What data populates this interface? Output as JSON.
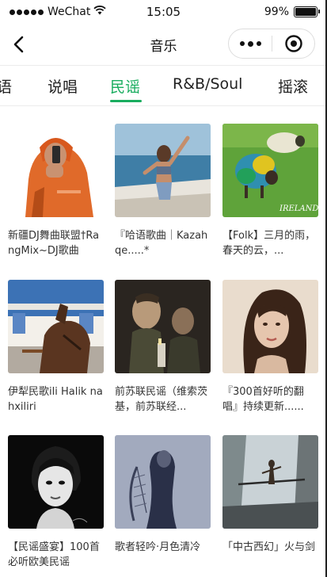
{
  "status_bar": {
    "carrier": "WeChat",
    "time": "15:05",
    "battery_text": "99%",
    "battery_level": 0.99
  },
  "nav": {
    "title": "音乐"
  },
  "tabs": [
    {
      "label": "语",
      "active": false
    },
    {
      "label": "说唱",
      "active": false
    },
    {
      "label": "民谣",
      "active": true
    },
    {
      "label": "R&B/Soul",
      "active": false
    },
    {
      "label": "摇滚",
      "active": false
    }
  ],
  "playlists": [
    {
      "title": "新疆DJ舞曲联盟†RangMix~DJ歌曲",
      "cover": "hoodie-man"
    },
    {
      "title": "『哈语歌曲｜Kazahqe.....*",
      "cover": "boat-girl"
    },
    {
      "title": "【Folk】三月的雨，春天的云，...",
      "cover": "colored-sheep",
      "cover_text": "IRELAND"
    },
    {
      "title": "伊犁民歌ili Halik nahxiliri",
      "cover": "horse-cart"
    },
    {
      "title": "前苏联民谣（维索茨基，前苏联经...",
      "cover": "soldiers"
    },
    {
      "title": "『300首好听的翻唱』持续更新......",
      "cover": "woman-portrait"
    },
    {
      "title": "【民谣盛宴】100首必听欧美民谣",
      "cover": "audrey-portrait"
    },
    {
      "title": "歌者轻吟·月色清冷",
      "cover": "harp-figure"
    },
    {
      "title": "「中古西幻」火与剑",
      "cover": "fantasy-warrior"
    }
  ],
  "colors": {
    "accent": "#1aad5f"
  }
}
